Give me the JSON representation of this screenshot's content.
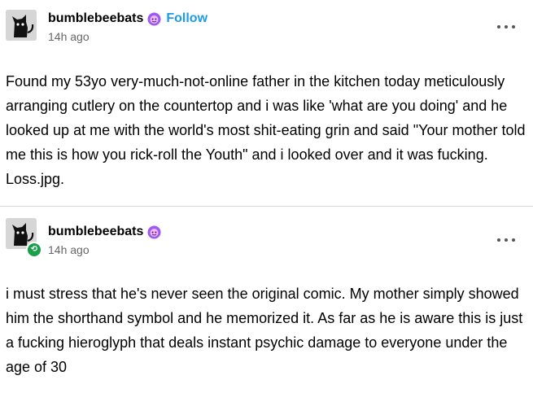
{
  "posts": [
    {
      "username": "bumblebeebats",
      "follow_label": "Follow",
      "timestamp": "14h ago",
      "body": "Found my 53yo very-much-not-online father in the kitchen today meticulously arranging cutlery on the countertop and i was like 'what are you doing' and he looked up at me with the world's most shit-eating grin and said \"Your mother told me this is how you rick-roll the Youth\" and i looked over and it was fucking. Loss.jpg."
    },
    {
      "username": "bumblebeebats",
      "timestamp": "14h ago",
      "body": "i must stress that he's never seen the original comic. My mother simply showed him the shorthand symbol and he memorized it. As far as he is aware this is just a fucking hieroglyph that deals instant psychic damage to everyone under the age of 30"
    }
  ],
  "icons": {
    "avatar": "cat-avatar",
    "badge": "purple-face-badge-icon",
    "reblog": "reblog-icon",
    "more": "more-options-icon"
  },
  "colors": {
    "follow": "#1c9be8",
    "badge": "#9b59f5",
    "reblog": "#1a9e4a",
    "timestamp": "#666666"
  }
}
